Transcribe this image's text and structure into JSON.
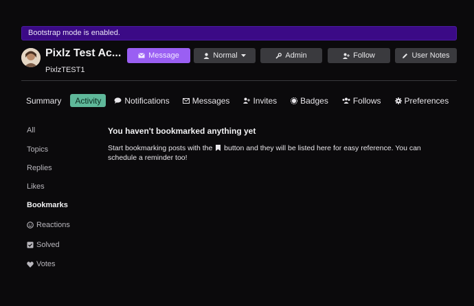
{
  "banner": {
    "text": "Bootstrap mode is enabled."
  },
  "profile": {
    "display_name": "Pixlz Test Ac...",
    "username": "PixlzTEST1"
  },
  "actions": {
    "message": "Message",
    "normal": "Normal",
    "admin": "Admin",
    "follow": "Follow",
    "user_notes": "User Notes"
  },
  "nav": [
    {
      "label": "Summary",
      "icon": ""
    },
    {
      "label": "Activity",
      "icon": ""
    },
    {
      "label": "Notifications",
      "icon": "comment-icon"
    },
    {
      "label": "Messages",
      "icon": "envelope-icon"
    },
    {
      "label": "Invites",
      "icon": "user-plus-icon"
    },
    {
      "label": "Badges",
      "icon": "certificate-icon"
    },
    {
      "label": "Follows",
      "icon": "users-icon"
    },
    {
      "label": "Preferences",
      "icon": "gear-icon"
    }
  ],
  "sidebar": [
    {
      "label": "All"
    },
    {
      "label": "Topics"
    },
    {
      "label": "Replies"
    },
    {
      "label": "Likes"
    },
    {
      "label": "Bookmarks"
    },
    {
      "label": "Reactions",
      "icon": "smile-icon"
    },
    {
      "label": "Solved",
      "icon": "check-square-icon"
    },
    {
      "label": "Votes",
      "icon": "heart-icon"
    }
  ],
  "empty_state": {
    "title": "You haven't bookmarked anything yet",
    "body_before": "Start bookmarking posts with the",
    "body_after": "button and they will be listed here for easy reference. You can schedule a reminder too!"
  },
  "colors": {
    "background": "#0b0a0c",
    "banner": "#3b0a86",
    "primary": "#9a5ff3",
    "active_tab": "#5fb89a",
    "button": "#3a3a3e"
  }
}
